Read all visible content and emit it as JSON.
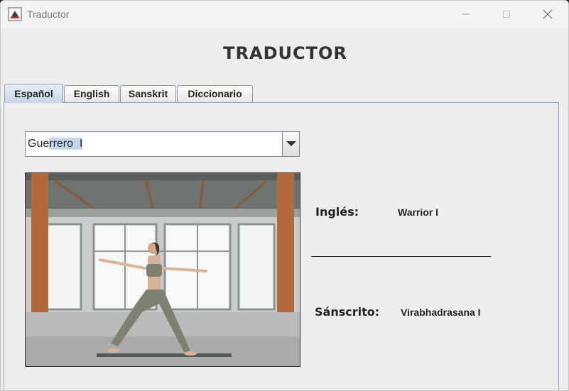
{
  "window": {
    "title": "Traductor",
    "controls": [
      "minimize-icon",
      "maximize-icon",
      "close-icon"
    ]
  },
  "app": {
    "heading": "TRADUCTOR"
  },
  "tabs": [
    {
      "label": "Español",
      "active": true
    },
    {
      "label": "English",
      "active": false
    },
    {
      "label": "Sanskrit",
      "active": false
    },
    {
      "label": "Diccionario",
      "active": false
    }
  ],
  "pose_select": {
    "value_start": "Gue",
    "value_selected": "rrero  I",
    "icon": "chevron-down-icon"
  },
  "pose_image": {
    "description_icon": "yoga-pose-photo"
  },
  "translations": {
    "english_label": "Inglés:",
    "english_value": "Warrior I",
    "sanskrit_label": "Sánscrito:",
    "sanskrit_value": "Virabhadrasana I"
  },
  "colors": {
    "active_tab": "#c7d7e7",
    "selection": "#c6d7ec",
    "panel_border": "#8fa7c4"
  }
}
